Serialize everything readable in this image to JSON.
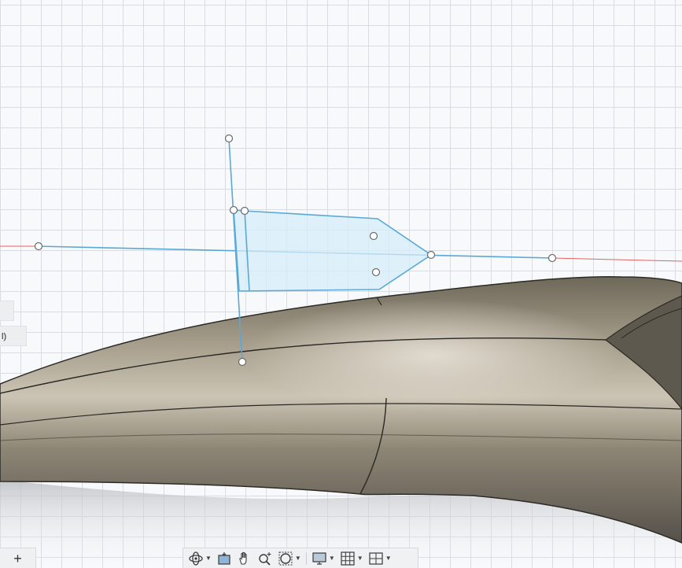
{
  "canvas": {
    "grid_color": "#d9dde2",
    "background_color": "#f8f9fb",
    "sketch_color": "#5aa8d6",
    "sketch_fill": "#d6ecf8",
    "axis_red": "#e46060",
    "body_color": "#8e8574"
  },
  "side_tabs": [
    {
      "label": ""
    },
    {
      "label": "l)"
    }
  ],
  "bottom_left": {
    "add_label": "+"
  },
  "nav_toolbar": {
    "items": [
      {
        "icon": "orbit-icon",
        "has_dropdown": true
      },
      {
        "icon": "look-at-icon",
        "has_dropdown": false
      },
      {
        "icon": "pan-hand-icon",
        "has_dropdown": false
      },
      {
        "icon": "zoom-icon",
        "has_dropdown": false
      },
      {
        "icon": "fit-window-icon",
        "has_dropdown": true
      },
      {
        "icon": "display-settings-icon",
        "has_dropdown": true
      },
      {
        "icon": "grid-icon",
        "has_dropdown": true
      },
      {
        "icon": "viewports-icon",
        "has_dropdown": true
      }
    ]
  }
}
